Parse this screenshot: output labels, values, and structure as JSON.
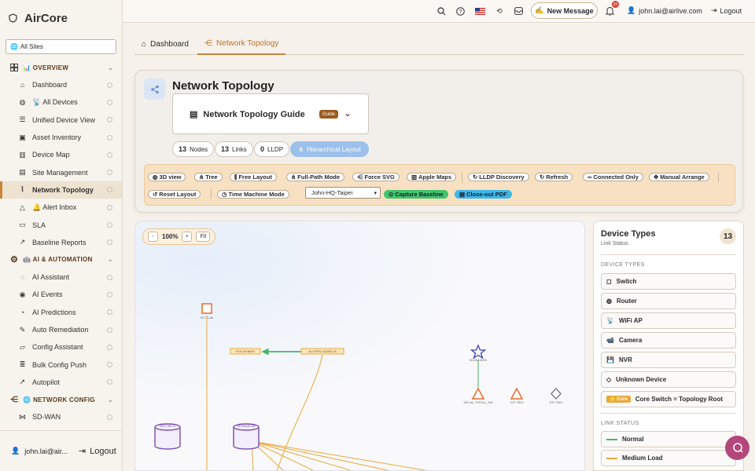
{
  "app": {
    "name": "AirCore"
  },
  "sidebar": {
    "site": "All Sites",
    "sections": [
      {
        "label": "📊 OVERVIEW",
        "items": [
          "Dashboard",
          "📡 All Devices",
          "Unified Device View",
          "Asset Inventory",
          "Device Map",
          "Site Management",
          "Network Topology",
          "🔔 Alert Inbox",
          "SLA",
          "Baseline Reports"
        ]
      },
      {
        "label": "🤖 AI & AUTOMATION",
        "items": [
          "AI Assistant",
          "AI Events",
          "AI Predictions",
          "Auto Remediation",
          "Config Assistant",
          "Bulk Config Push",
          "Autopilot"
        ]
      },
      {
        "label": "🌐 NETWORK CONFIG",
        "items": [
          "SD-WAN"
        ]
      }
    ],
    "footer_user": "john.lai@air...",
    "footer_logout": "Logout"
  },
  "topbar": {
    "new_message": "New Message",
    "badge": "20",
    "user": "john.lai@airlive.com",
    "logout": "Logout"
  },
  "tabs": [
    "Dashboard",
    "Network Topology"
  ],
  "header": {
    "title": "Network Topology",
    "guide_title": "Network Topology Guide",
    "guide_badge": "Guide",
    "stats": [
      {
        "value": "13",
        "label": "Nodes"
      },
      {
        "value": "13",
        "label": "Links"
      },
      {
        "value": "0",
        "label": "LLDP"
      }
    ],
    "layout_button": "Hierarchical Layout"
  },
  "toolbar": {
    "row1": [
      "3D view",
      "Tree",
      "Free Layout",
      "Full-Path Mode",
      "Force SVG",
      "Apple Maps",
      "LLDP Discovery",
      "Refresh",
      "Connected Only",
      "Manual Arrange"
    ],
    "row2": [
      "Reset Layout",
      "Time Machine Mode"
    ],
    "site_select": "John-HQ-Taipei",
    "capture": "Capture Baseline",
    "closeout": "Close-out PDF"
  },
  "canvas": {
    "zoom": "100%",
    "zoom_out": "-",
    "zoom_in": "+",
    "fit": "Fit",
    "nodes": [
      {
        "label": "OLT-7-Lab"
      },
      {
        "label": "POE-SGHB40V"
      },
      {
        "label": "ALLOPEN-SG4800-X5"
      },
      {
        "label": "WLAN-DAGW"
      },
      {
        "label": "AIR-Lite_TOP2AC_Test"
      },
      {
        "label": "TOP-TBXX"
      },
      {
        "label": "TOP-TBXX"
      },
      {
        "label": "NVR-TBD-X"
      },
      {
        "label": "STORAGE-AD"
      }
    ]
  },
  "panel": {
    "title": "Device Types",
    "subtitle": "Link Status",
    "count": "13",
    "device_types_label": "DEVICE TYPES",
    "device_types": [
      "Switch",
      "Router",
      "WiFi AP",
      "Camera",
      "NVR",
      "Unknown Device"
    ],
    "core_tag": "Core",
    "core_label": "Core Switch = Topology Root",
    "link_status_label": "LINK STATUS",
    "link_status": [
      "Normal",
      "Medium Load"
    ]
  },
  "colors": {
    "accent": "#c9843a",
    "normal": "#47b56a",
    "medium": "#e8a93b",
    "nvr": "#7a4fb0",
    "alarm": "#e76b2d"
  }
}
